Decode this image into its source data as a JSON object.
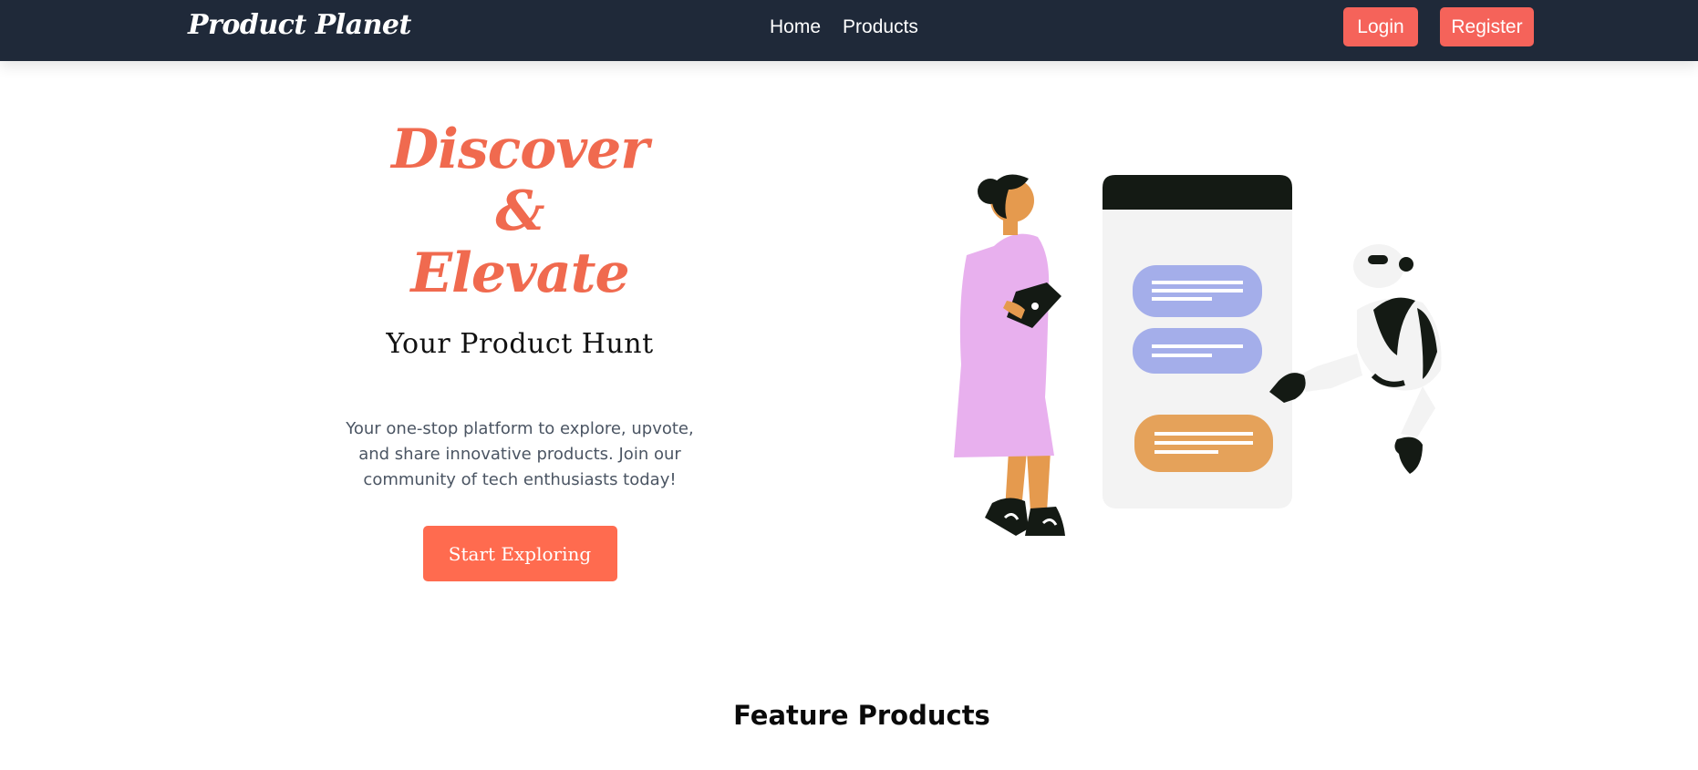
{
  "navbar": {
    "brand": "Product Planet",
    "links": [
      {
        "label": "Home"
      },
      {
        "label": "Products"
      }
    ],
    "login_label": "Login",
    "register_label": "Register"
  },
  "hero": {
    "headline_line1": "Discover",
    "headline_line2": "&",
    "headline_line3": "Elevate",
    "subtitle": "Your Product Hunt",
    "description": "Your one-stop platform to explore, upvote, and share innovative products. Join our community of tech enthusiasts today!",
    "cta_label": "Start Exploring"
  },
  "featured": {
    "title": "Feature Products"
  },
  "colors": {
    "navbar_bg": "#1f2939",
    "accent": "#f5635a",
    "headline": "#f06a4f",
    "cta": "#ff6b4f"
  }
}
